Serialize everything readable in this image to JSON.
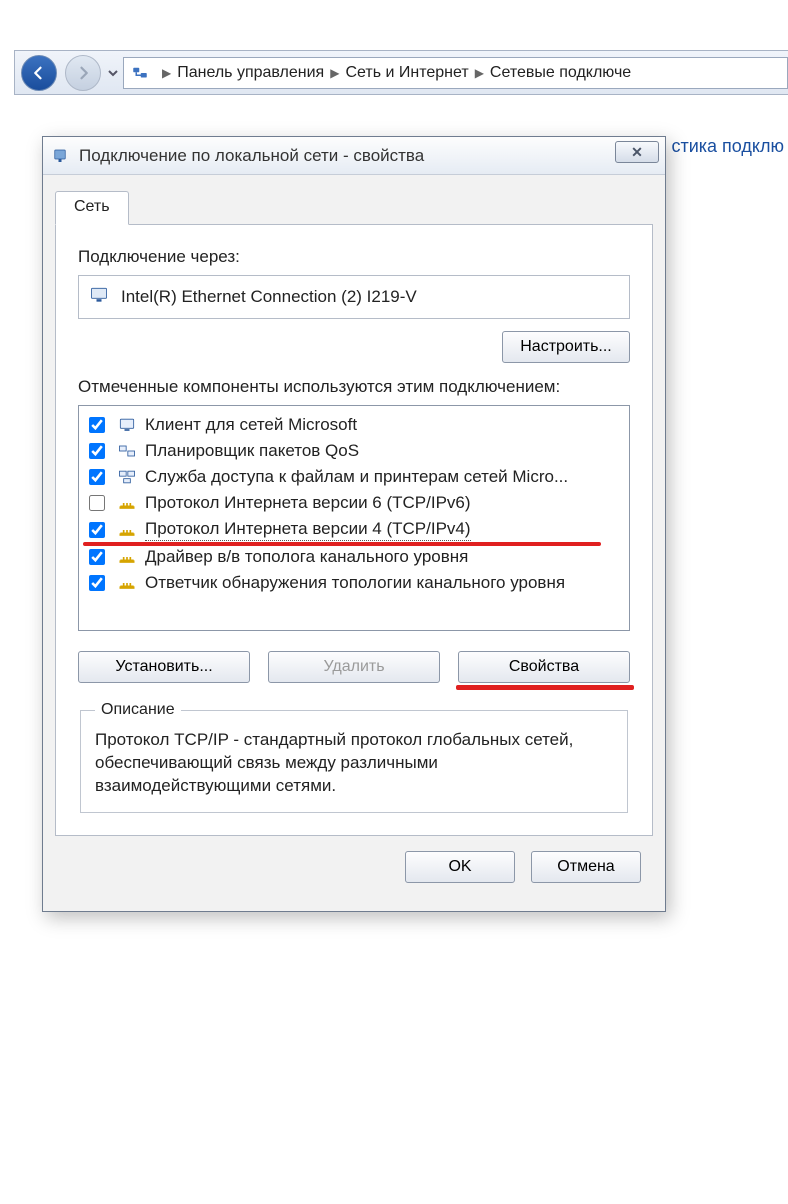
{
  "breadcrumbs": {
    "items": [
      "Панель управления",
      "Сеть и Интернет",
      "Сетевые подключе"
    ]
  },
  "background": {
    "partial_link": "стика подклю"
  },
  "dialog": {
    "title": "Подключение по локальной сети - свойства",
    "tab_label": "Сеть",
    "connect_via_label": "Подключение через:",
    "adapter_name": "Intel(R) Ethernet Connection (2) I219-V",
    "configure_btn": "Настроить...",
    "components_label": "Отмеченные компоненты используются этим подключением:",
    "components": [
      {
        "checked": true,
        "icon": "client",
        "label": "Клиент для сетей Microsoft"
      },
      {
        "checked": true,
        "icon": "sched",
        "label": "Планировщик пакетов QoS"
      },
      {
        "checked": true,
        "icon": "share",
        "label": "Служба доступа к файлам и принтерам сетей Micro..."
      },
      {
        "checked": false,
        "icon": "proto",
        "label": "Протокол Интернета версии 6 (TCP/IPv6)"
      },
      {
        "checked": true,
        "icon": "proto",
        "label": "Протокол Интернета версии 4 (TCP/IPv4)",
        "selected": true,
        "highlighted": true
      },
      {
        "checked": true,
        "icon": "proto",
        "label": "Драйвер в/в тополога канального уровня"
      },
      {
        "checked": true,
        "icon": "proto",
        "label": "Ответчик обнаружения топологии канального уровня"
      }
    ],
    "install_btn": "Установить...",
    "remove_btn": "Удалить",
    "properties_btn": "Свойства",
    "properties_highlighted": true,
    "desc_legend": "Описание",
    "desc_body": "Протокол TCP/IP - стандартный протокол глобальных сетей, обеспечивающий связь между различными взаимодействующими сетями.",
    "ok_btn": "OK",
    "cancel_btn": "Отмена"
  }
}
